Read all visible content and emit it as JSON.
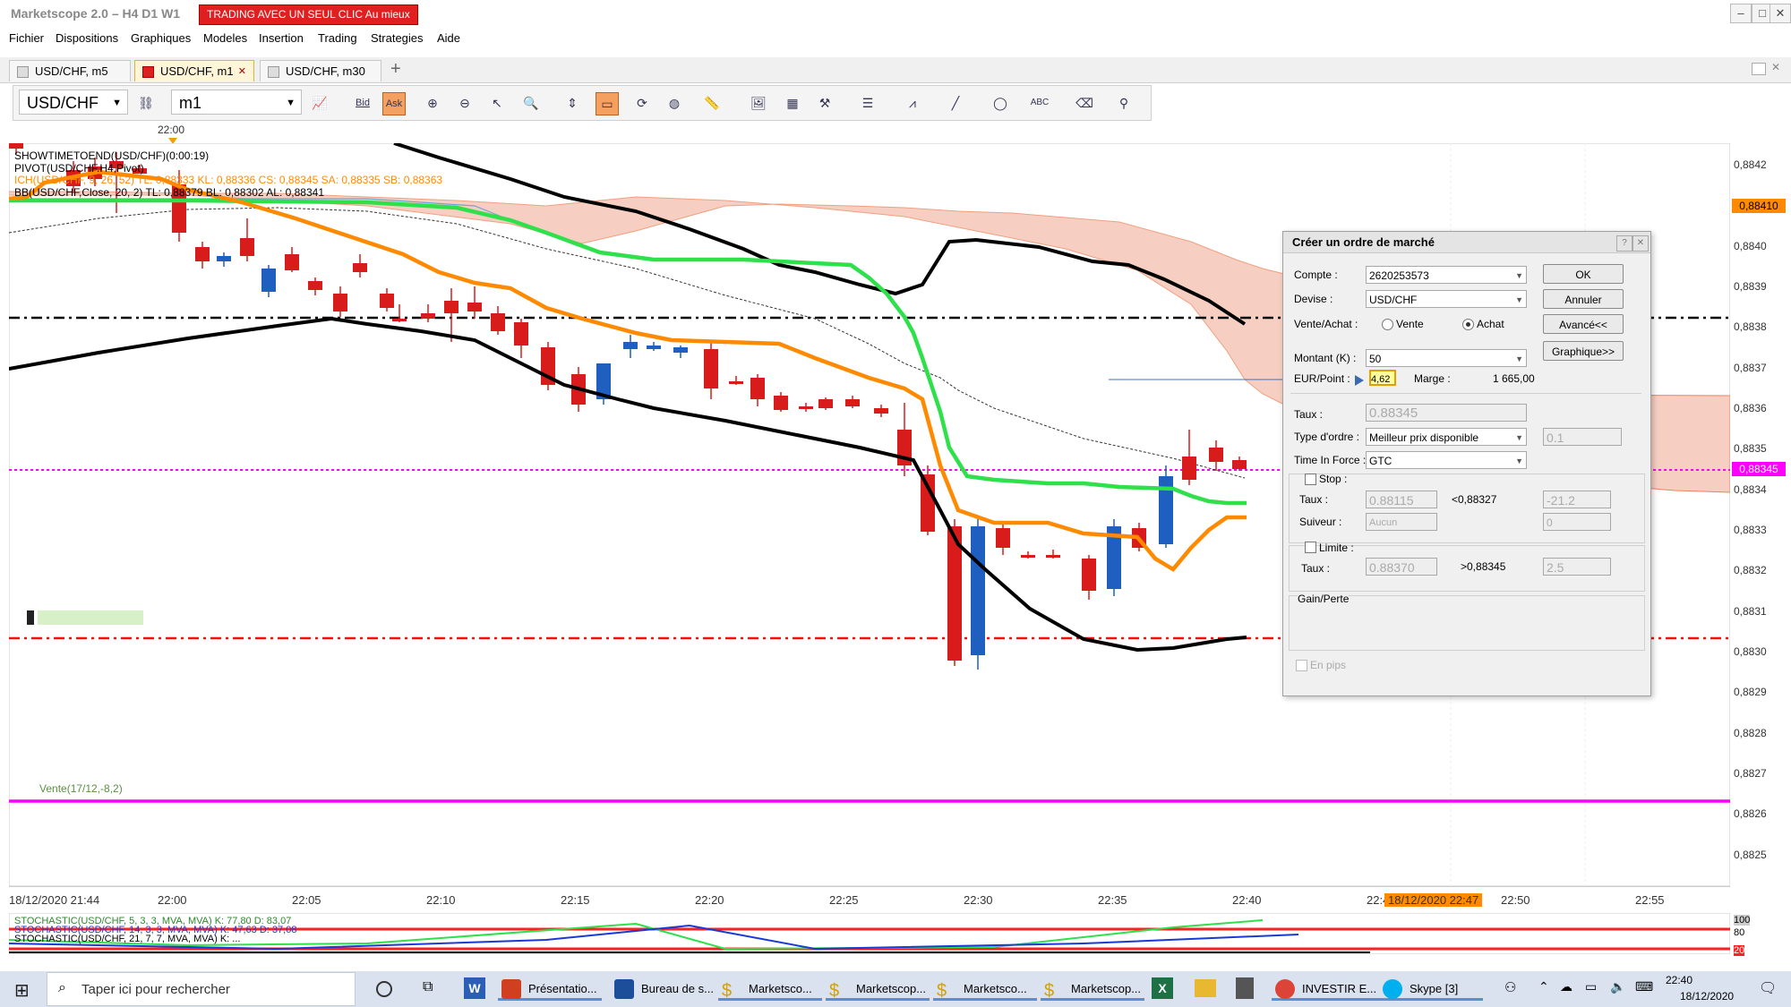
{
  "window": {
    "title": "Marketscope 2.0 – H4 D1 W1",
    "promo": "TRADING AVEC UN SEUL CLIC Au mieux",
    "controls": [
      "–",
      "□",
      "✕"
    ]
  },
  "menu": [
    "Fichier",
    "Dispositions",
    "Graphiques",
    "Modeles",
    "Insertion",
    "Trading",
    "Strategies",
    "Aide"
  ],
  "tabs": [
    {
      "label": "USD/CHF, m5",
      "active": false
    },
    {
      "label": "USD/CHF, m1",
      "active": true,
      "close": "✕"
    },
    {
      "label": "USD/CHF, m30",
      "active": false
    },
    {
      "label": "+"
    }
  ],
  "toolbar": {
    "symbol": "USD/CHF",
    "timeframe": "m1",
    "bid": "Bid",
    "ask": "Ask"
  },
  "chart": {
    "time_marker": "22:00",
    "indicators": [
      "SHOWTIMETOEND(USD/CHF)(0:00:19)",
      "PIVOT(USD/CHF.H4,Pivot)",
      "ICH(USD/CHF, 9, 26, 52)   TL: 0,88333   KL: 0,88336   CS: 0,88345   SA: 0,88335   SB: 0,88363",
      "BB(USD/CHF,Close, 20, 2)   TL: 0,88379   BL: 0,88302   AL: 0,88341"
    ],
    "price_labels": [
      "0,8842",
      "0,8841",
      "0,8840",
      "0,8839",
      "0,8838",
      "0,8837",
      "0,8836",
      "0,8835",
      "0,8834",
      "0,8833",
      "0,8832",
      "0,8831",
      "0,8830",
      "0,8829",
      "0,8828",
      "0,8827",
      "0,8826",
      "0,8825"
    ],
    "price_tag_orange": "0,88410",
    "price_tag_magenta": "0,88345",
    "time_labels": [
      "18/12/2020 21:44",
      "22:00",
      "22:05",
      "22:10",
      "22:15",
      "22:20",
      "22:25",
      "22:30",
      "22:35",
      "22:40",
      "22:4",
      "22:50",
      "22:55"
    ],
    "time_highlight": "18/12/2020 22:47",
    "position_label": "Vente(17/12,-8,2)",
    "stochastic_labels": [
      "STOCHASTIC(USD/CHF, 5, 3, 3, MVA, MVA)  K: 77,80  D: 83,07",
      "STOCHASTIC(USD/CHF, 14, 3, 3, MVA, MVA)  K: 47,63  D: 37,08",
      "STOCHASTIC(USD/CHF, 21, 7, 7, MVA, MVA)  K: ..."
    ],
    "stoch_axis": [
      "100",
      "80",
      "20"
    ]
  },
  "dialog": {
    "title": "Créer un ordre de marché",
    "help": "?",
    "close": "✕",
    "compte_label": "Compte :",
    "compte": "2620253573",
    "devise_label": "Devise :",
    "devise": "USD/CHF",
    "side_label": "Vente/Achat :",
    "vente": "Vente",
    "achat": "Achat",
    "montant_label": "Montant (K) :",
    "montant": "50",
    "eurpoint_label": "EUR/Point :",
    "eurpoint": "4,62",
    "marge_label": "Marge :",
    "marge": "1 665,00",
    "taux_label": "Taux :",
    "taux": "0.88345",
    "type_label": "Type d'ordre :",
    "type": "Meilleur prix disponible",
    "type_extra": "0.1",
    "tif_label": "Time In Force :",
    "tif": "GTC",
    "stop_label": "Stop :",
    "stop_taux_label": "Taux :",
    "stop_taux": "0.88115",
    "stop_cmp": "<0,88327",
    "stop_pips": "-21.2",
    "suiveur_label": "Suiveur :",
    "suiveur": "Aucun",
    "suiveur_val": "0",
    "limite_label": "Limite :",
    "limite_taux_label": "Taux :",
    "limite_taux": "0.88370",
    "limite_cmp": ">0,88345",
    "limite_pips": "2.5",
    "gain_label": "Gain/Perte",
    "pips_label": "En pips",
    "ok": "OK",
    "annuler": "Annuler",
    "avance": "Avancé<<",
    "graphique": "Graphique>>"
  },
  "taskbar": {
    "search_placeholder": "Taper ici pour rechercher",
    "apps": [
      "Présentatio...",
      "Bureau de s...",
      "Marketsco...",
      "Marketscop...",
      "Marketsco...",
      "Marketscop...",
      "INVESTIR E...",
      "Skype [3]"
    ],
    "time": "22:40",
    "date": "18/12/2020"
  },
  "colors": {
    "bull": "#1f5fbf",
    "bear": "#d81c1c",
    "kijun_green": "#2ee04a",
    "tenkan_orange": "#ff8a00",
    "bb_black": "#000000",
    "cloud": "#f6cfc2",
    "magenta": "#ff00ff",
    "promo_red": "#e02020"
  }
}
